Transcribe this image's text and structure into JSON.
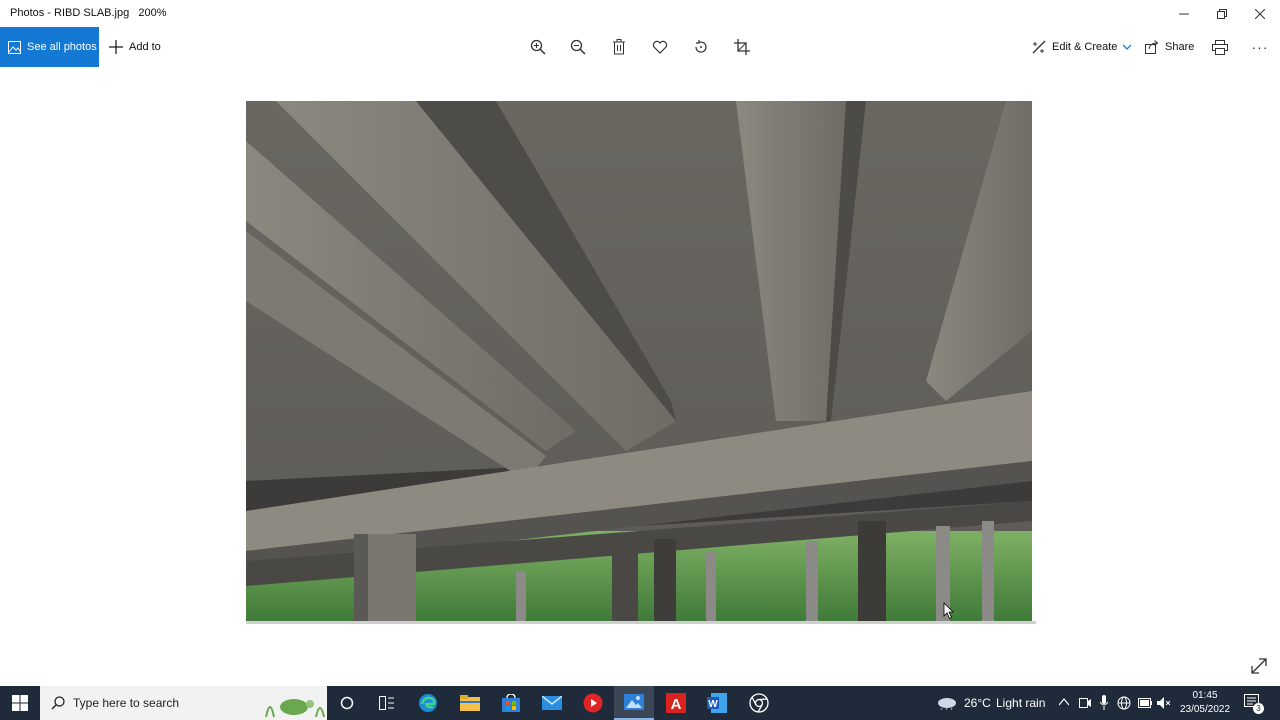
{
  "window": {
    "title": "Photos - RIBD SLAB.jpg",
    "zoom": "200%",
    "controls": [
      "minimize",
      "restore",
      "close"
    ]
  },
  "toolbar": {
    "see_all_label": "See all photos",
    "add_to_label": "Add to",
    "center_icons": [
      "zoom-in-icon",
      "zoom-out-icon",
      "delete-icon",
      "favorite-icon",
      "rotate-icon",
      "crop-icon"
    ],
    "edit_create_label": "Edit & Create",
    "share_label": "Share",
    "more_label": "···"
  },
  "photo": {
    "description_subject": "ribbed concrete slab underside"
  },
  "taskbar": {
    "search_placeholder": "Type here to search",
    "weather_temp": "26°C",
    "weather_text": "Light rain",
    "time": "01:45",
    "date": "23/05/2022",
    "notification_count": "3",
    "apps": [
      "cortana",
      "task-view",
      "edge",
      "file-explorer",
      "store",
      "mail",
      "youtube",
      "photos",
      "acrobat",
      "word",
      "chrome"
    ]
  },
  "colors": {
    "accent": "#1479d4",
    "taskbar": "#1f2a3a"
  }
}
